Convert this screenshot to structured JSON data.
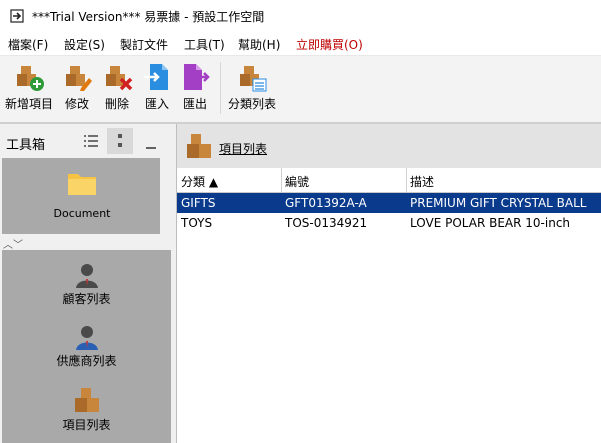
{
  "window": {
    "title": "***Trial Version*** 易票據 - 預設工作空間"
  },
  "menu": {
    "items": [
      "檔案(F)",
      "設定(S)",
      "製訂文件",
      "工具(T)",
      "幫助(H)",
      "立即購買(O)"
    ]
  },
  "toolbar": {
    "buttons": [
      "新增項目",
      "修改",
      "刪除",
      "匯入",
      "匯出",
      "分類列表"
    ]
  },
  "toolbox": {
    "title": "工具箱",
    "document_label": "Document",
    "items": [
      "顧客列表",
      "供應商列表",
      "項目列表"
    ]
  },
  "main": {
    "title": "項目列表",
    "columns": [
      "分類 ▲",
      "編號",
      "描述"
    ],
    "rows": [
      [
        "GIFTS",
        "GFT01392A-A",
        "PREMIUM GIFT CRYSTAL BALL"
      ],
      [
        "TOYS",
        "TOS-0134921",
        "LOVE POLAR BEAR 10-inch"
      ]
    ],
    "selected_row": 0
  },
  "colors": {
    "selection": "#0a3a8c",
    "buy_menu": "#c00000",
    "toolbox_panel": "#a9a9a9"
  }
}
